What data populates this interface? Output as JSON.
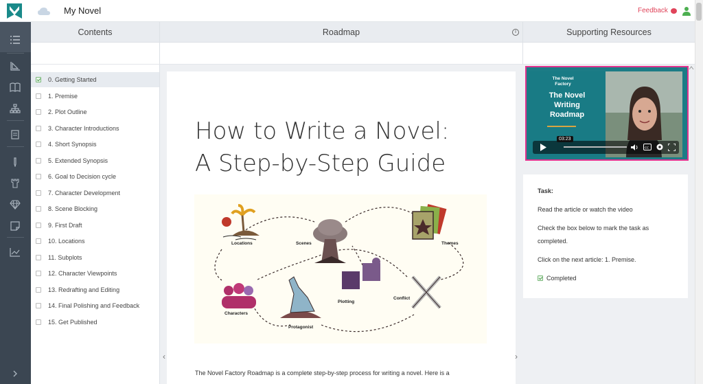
{
  "app": {
    "title": "My Novel",
    "feedback_label": "Feedback",
    "brand_color": "#1a8a8a",
    "accent_color": "#e0445a"
  },
  "columns": {
    "contents": "Contents",
    "roadmap": "Roadmap",
    "resources": "Supporting Resources"
  },
  "rail_icons": [
    "list-icon",
    "chart-icon",
    "book-icon",
    "org-chart-icon",
    "notebook-icon",
    "pen-icon",
    "tower-icon",
    "gem-icon",
    "note-icon",
    "trend-icon",
    "expand-icon"
  ],
  "contents": [
    {
      "label": "0. Getting Started",
      "checked": true
    },
    {
      "label": "1. Premise",
      "checked": false
    },
    {
      "label": "2. Plot Outline",
      "checked": false
    },
    {
      "label": "3. Character Introductions",
      "checked": false
    },
    {
      "label": "4. Short Synopsis",
      "checked": false
    },
    {
      "label": "5. Extended Synopsis",
      "checked": false
    },
    {
      "label": "6. Goal to Decision cycle",
      "checked": false
    },
    {
      "label": "7. Character Development",
      "checked": false
    },
    {
      "label": "8. Scene Blocking",
      "checked": false
    },
    {
      "label": "9. First Draft",
      "checked": false
    },
    {
      "label": "10. Locations",
      "checked": false
    },
    {
      "label": "11. Subplots",
      "checked": false
    },
    {
      "label": "12. Character Viewpoints",
      "checked": false
    },
    {
      "label": "13. Redrafting and Editing",
      "checked": false
    },
    {
      "label": "14. Final Polishing and Feedback",
      "checked": false
    },
    {
      "label": "15. Get Published",
      "checked": false
    }
  ],
  "article": {
    "heading_line1": "How to Write a Novel:",
    "heading_line2": "A Step-by-Step Guide",
    "body": "The Novel Factory Roadmap is a complete step-by-step process for writing a novel. Here is a",
    "illustration_labels": {
      "locations": "Locations",
      "scenes": "Scenes",
      "themes": "Themes",
      "characters": "Characters",
      "plotting": "Plotting",
      "conflict": "Conflict",
      "protagonist": "Protagonist"
    }
  },
  "video": {
    "small_title": "The Novel Factory",
    "big_title": "The Novel Writing Roadmap",
    "time": "03:23"
  },
  "task": {
    "heading": "Task:",
    "line1": "Read the article or watch the video",
    "line2a": "Check the box below to mark the task as",
    "line2b": "completed.",
    "line3": "Click on the next article: 1. Premise.",
    "completed_label": "Completed"
  }
}
